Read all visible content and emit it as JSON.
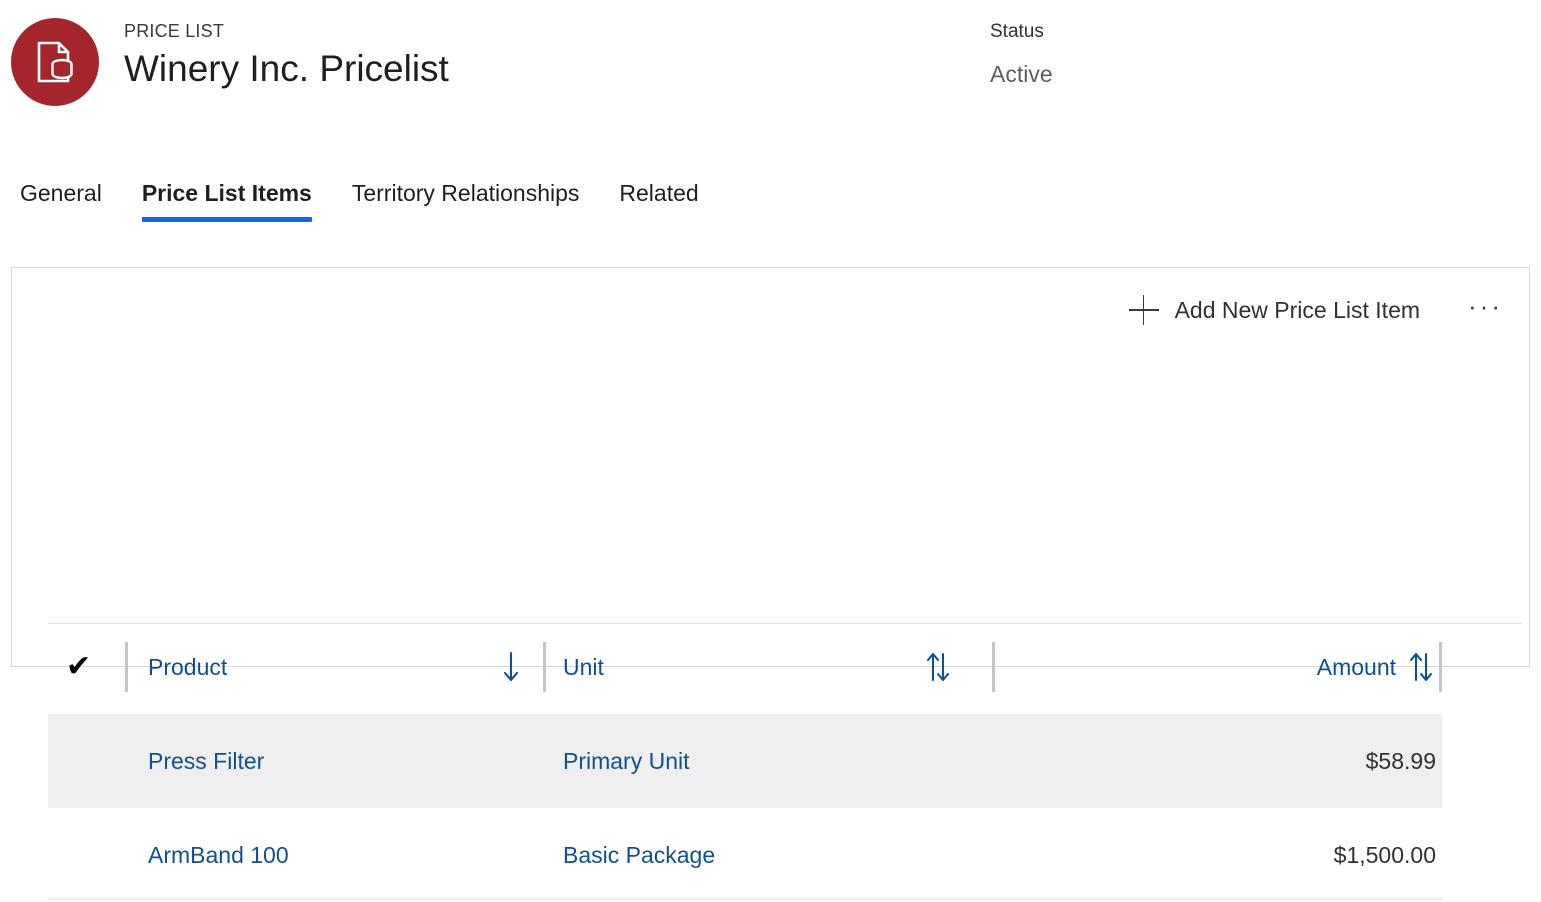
{
  "record_header": {
    "entity_kicker": "PRICE LIST",
    "title": "Winery Inc. Pricelist",
    "avatar_icon": "price-list-document-coins-icon",
    "avatar_color": "#a4262c",
    "status_label": "Status",
    "status_value": "Active"
  },
  "tabs": {
    "accent_color": "#1267e0",
    "items": [
      {
        "label": "General",
        "active": false
      },
      {
        "label": "Price List Items",
        "active": true
      },
      {
        "label": "Territory Relationships",
        "active": false
      },
      {
        "label": "Related",
        "active": false
      }
    ]
  },
  "subgrid": {
    "command_bar": {
      "add_icon": "plus-icon",
      "add_label": "Add New Price List Item",
      "overflow_label": "···"
    },
    "select_all": {
      "icon": "checkmark-icon",
      "glyph": "✔"
    },
    "columns": [
      {
        "key": "product",
        "label": "Product",
        "sort_icon": "sort-descending-arrow-icon",
        "align": "left"
      },
      {
        "key": "unit",
        "label": "Unit",
        "sort_icon": "sort-unsorted-arrows-icon",
        "align": "left"
      },
      {
        "key": "amount",
        "label": "Amount",
        "sort_icon": "sort-unsorted-arrows-icon",
        "align": "right"
      }
    ],
    "link_color": "#10508f",
    "rows": [
      {
        "product": "Press Filter",
        "unit": "Primary Unit",
        "amount": "$58.99",
        "selected": true
      },
      {
        "product": "ArmBand 100",
        "unit": "Basic Package",
        "amount": "$1,500.00",
        "selected": false
      }
    ]
  }
}
